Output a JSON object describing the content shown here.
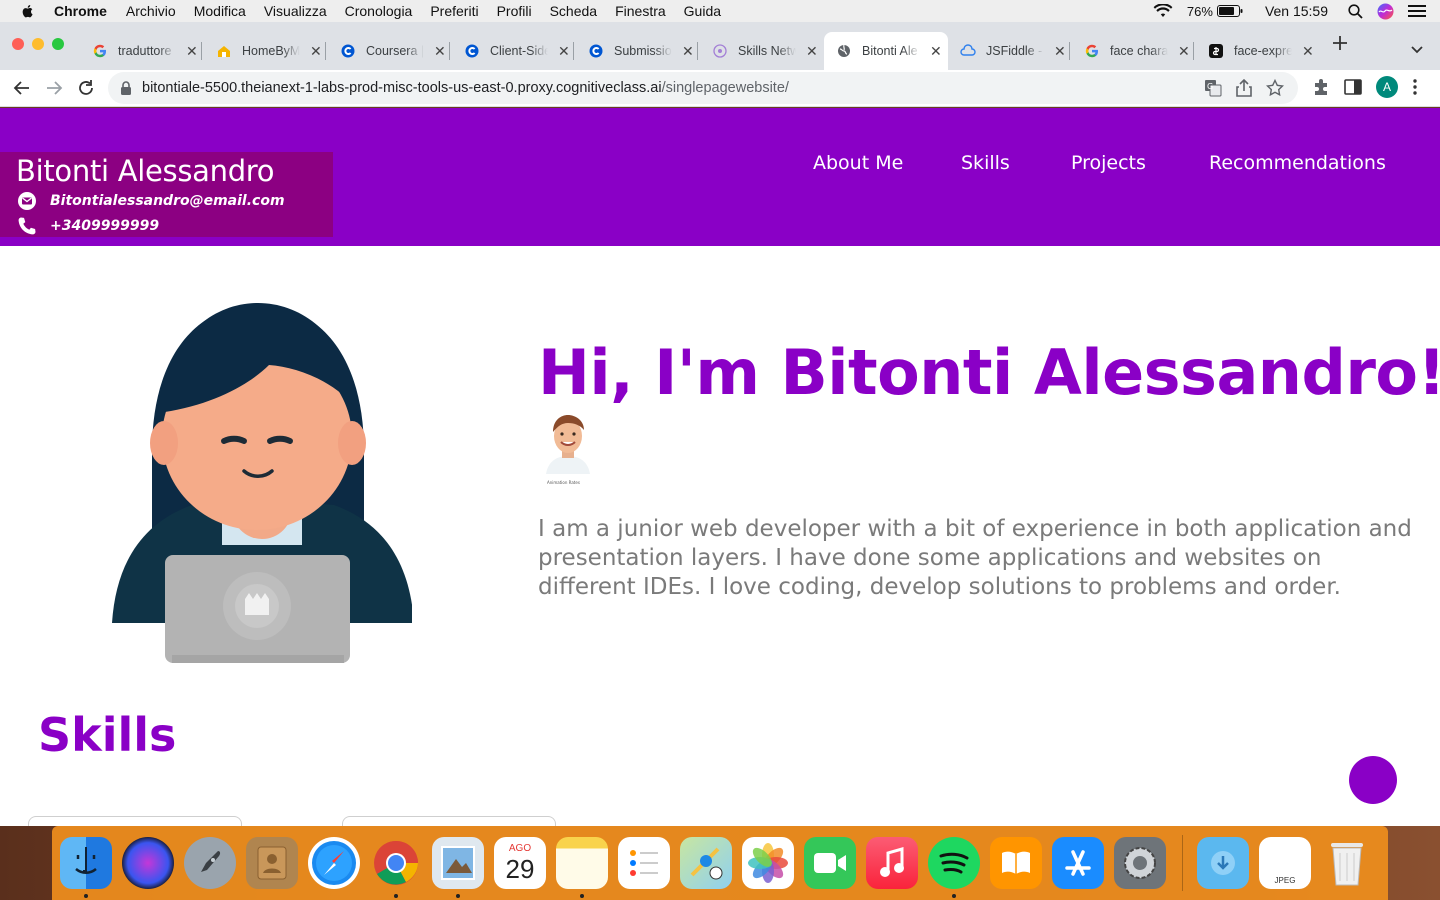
{
  "menubar": {
    "app_name": "Chrome",
    "menus": [
      "Archivio",
      "Modifica",
      "Visualizza",
      "Cronologia",
      "Preferiti",
      "Profili",
      "Scheda",
      "Finestra",
      "Guida"
    ],
    "battery": "76%",
    "clock": "Ven 15:59"
  },
  "tabs": [
    {
      "title": "traduttore",
      "icon": "google-icon"
    },
    {
      "title": "HomeByMe",
      "icon": "home-icon"
    },
    {
      "title": "Coursera |",
      "icon": "coursera-icon"
    },
    {
      "title": "Client-Side",
      "icon": "coursera-icon"
    },
    {
      "title": "Submission",
      "icon": "coursera-icon"
    },
    {
      "title": "Skills Netw",
      "icon": "skills-network-icon"
    },
    {
      "title": "Bitonti Ale",
      "icon": "globe-icon",
      "active": true
    },
    {
      "title": "JSFiddle -",
      "icon": "jsfiddle-icon"
    },
    {
      "title": "face chara",
      "icon": "google-icon"
    },
    {
      "title": "face-expre",
      "icon": "github-icon"
    }
  ],
  "address_bar": {
    "url_host": "bitontiale-5500.theianext-1-labs-prod-misc-tools-us-east-0.proxy.cognitiveclass.ai",
    "url_path": "/singlepagewebsite/",
    "profile_initial": "A"
  },
  "site": {
    "brand_name": "Bitonti Alessandro",
    "email": "Bitontialessandro@email.com",
    "phone": "+3409999999",
    "nav": [
      "About Me",
      "Skills",
      "Projects",
      "Recommendations"
    ],
    "hero_title": "Hi, I'm Bitonti Alessandro!",
    "memoji_caption": "Animation Rates",
    "bio": "I am a junior web developer with a bit of experience in both application and presentation layers. I have done some applications and websites on different IDEs. I love coding, develop solutions to problems and order.",
    "skills_title": "Skills"
  },
  "dock": {
    "items": [
      "finder-icon",
      "siri-icon",
      "launchpad-icon",
      "contacts-icon",
      "safari-icon",
      "chrome-icon",
      "preview-icon",
      "calendar-icon",
      "notes-icon",
      "reminders-icon",
      "maps-icon",
      "photos-icon",
      "facetime-icon",
      "music-icon",
      "spotify-icon",
      "books-icon",
      "app-store-icon",
      "system-preferences-icon",
      "downloads-folder-icon",
      "jpeg-file-icon",
      "trash-icon"
    ],
    "calendar_month": "AGO",
    "calendar_day": "29",
    "jpeg_label": "JPEG"
  },
  "colors": {
    "header": "#8a00c6",
    "brand_box": "#8c0082",
    "accent": "#8a00c6",
    "body_text": "#7a7a7a"
  }
}
